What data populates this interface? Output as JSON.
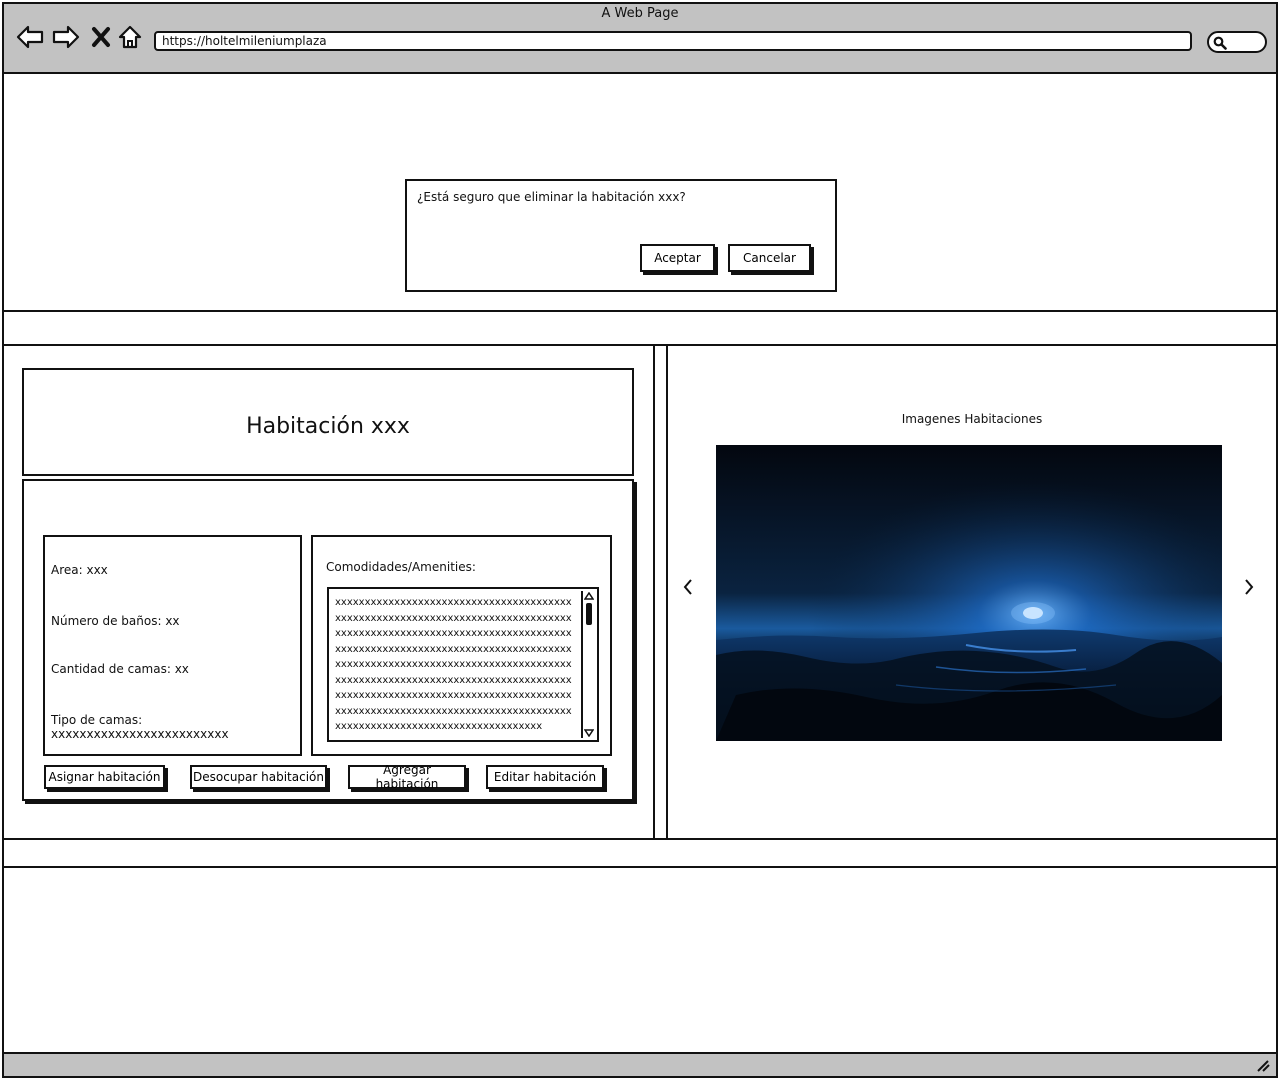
{
  "browser": {
    "title": "A Web Page",
    "url": "https://holtelmileniumplaza"
  },
  "dialog": {
    "message": "¿Está seguro que eliminar la habitación xxx?",
    "accept_label": "Aceptar",
    "cancel_label": "Cancelar"
  },
  "room": {
    "title": "Habitación xxx",
    "area": "Area: xxx",
    "bathrooms": "Número de baños: xx",
    "beds_count": "Cantidad de camas: xx",
    "bed_type": "Tipo de camas: xxxxxxxxxxxxxxxxxxxxxxxxx",
    "amenities_label": "Comodidades/Amenities:",
    "amenities_text": "xxxxxxxxxxxxxxxxxxxxxxxxxxxxxxxxxxxxxxxxxxxxxxxxxxxxxxxxxxxxxxxxxxxxxxxxxxxxxxxxxxxxxxxxxxxxxxxxxxxxxxxxxxxxxxxxxxxxxxxxxxxxxxxxxxxxxxxxxxxxxxxxxxxxxxxxxxxxxxxxxxxxxxxxxxxxxxxxxxxxxxxxxxxxxxxxxxxxxxxxxxxxxxxxxxxxxxxxxxxxxxxxxxxxxxxxxxxxxxxxxxxxxxxxxxxxxxxxxxxxxxxxxxxxxxxxxxxxxxxxxxxxxxxxxxxxxxxxxxxxxxxxxxxxxxxxxxxxxxxxxxxxxxxxxxxxxxxxxxxxxxxxxxxxxxxxxxx"
  },
  "actions": {
    "assign": "Asignar habitación",
    "vacate": "Desocupar habitación",
    "add": "Agregar habitación",
    "edit": "Editar habitación"
  },
  "gallery": {
    "title": "Imagenes Habitaciones",
    "prev_icon": "chevron-left-icon",
    "next_icon": "chevron-right-icon"
  },
  "colors": {
    "chrome": "#c2c2c2",
    "ink": "#111111"
  }
}
